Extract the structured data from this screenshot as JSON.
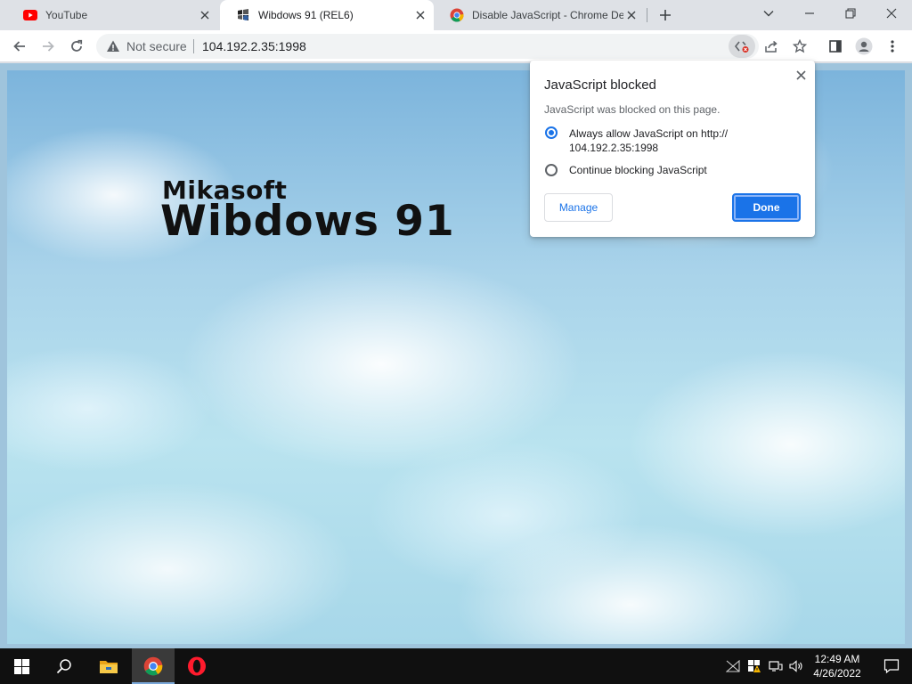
{
  "browser": {
    "tabs": [
      {
        "title": "YouTube",
        "favicon": "youtube-icon",
        "active": false
      },
      {
        "title": "Wibdows 91 (REL6)",
        "favicon": "wibdows-icon",
        "active": true
      },
      {
        "title": "Disable JavaScript - Chrome Dev",
        "favicon": "chrome-icon",
        "active": false
      }
    ],
    "security_label": "Not secure",
    "url": "104.192.2.35:1998"
  },
  "page": {
    "logo_company": "Mikasoft",
    "logo_product": "Wibdows 91"
  },
  "popup": {
    "title": "JavaScript blocked",
    "description": "JavaScript was blocked on this page.",
    "options": [
      {
        "label_line1": "Always allow JavaScript on http://",
        "label_line2": "104.192.2.35:1998",
        "selected": true
      },
      {
        "label_line1": "Continue blocking JavaScript",
        "label_line2": "",
        "selected": false
      }
    ],
    "manage_label": "Manage",
    "done_label": "Done"
  },
  "taskbar": {
    "apps": [
      "file-explorer-icon",
      "chrome-icon",
      "opera-icon"
    ],
    "time": "12:49 AM",
    "date": "4/26/2022"
  },
  "colors": {
    "accent": "#1a73e8",
    "taskbar": "#101010",
    "tabstrip": "#dee1e6"
  }
}
